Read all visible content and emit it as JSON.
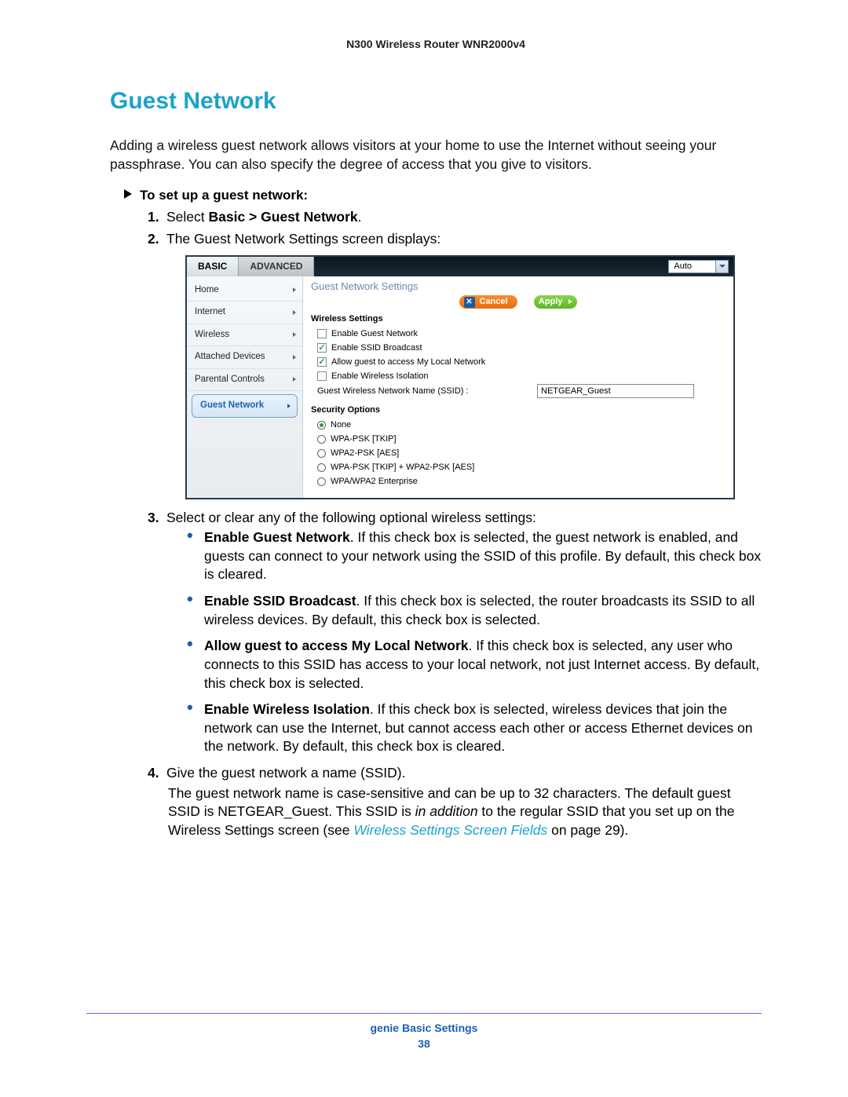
{
  "doc_header": "N300 Wireless Router WNR2000v4",
  "section_title": "Guest Network",
  "intro": "Adding a wireless guest network allows visitors at your home to use the Internet without seeing your passphrase. You can also specify the degree of access that you give to visitors.",
  "procedure_head": "To set up a guest network:",
  "steps": {
    "s1_num": "1.",
    "s1_pre": "Select ",
    "s1_bold": "Basic > Guest Network",
    "s1_post": ".",
    "s2_num": "2.",
    "s2_text": "The Guest Network Settings screen displays:",
    "s3_num": "3.",
    "s3_text": "Select or clear any of the following optional wireless settings:",
    "s4_num": "4.",
    "s4_text": "Give the guest network a name (SSID).",
    "s4_sub_pre": "The guest network name is case-sensitive and can be up to 32 characters. The default guest SSID is NETGEAR_Guest. This SSID is ",
    "s4_sub_italic": "in addition",
    "s4_sub_mid": " to the regular SSID that you set up on the Wireless Settings screen (see ",
    "s4_sub_link": "Wireless Settings Screen Fields ",
    "s4_sub_post": "on page 29)."
  },
  "bullets": {
    "b1_bold": "Enable Guest Network",
    "b1_text": ". If this check box is selected, the guest network is enabled, and guests can connect to your network using the SSID of this profile. By default, this check box is cleared.",
    "b2_bold": "Enable SSID Broadcast",
    "b2_text": ". If this check box is selected, the router broadcasts its SSID to all wireless devices. By default, this check box is selected.",
    "b3_bold": "Allow guest to access My Local Network",
    "b3_text": ". If this check box is selected, any user who connects to this SSID has access to your local network, not just Internet access. By default, this check box is selected.",
    "b4_bold": "Enable Wireless Isolation",
    "b4_text": ". If this check box is selected, wireless devices that join the network can use the Internet, but cannot access each other or access Ethernet devices on the network. By default, this check box is cleared."
  },
  "ui": {
    "tab_basic": "BASIC",
    "tab_advanced": "ADVANCED",
    "auto": "Auto",
    "sidebar": [
      "Home",
      "Internet",
      "Wireless",
      "Attached Devices",
      "Parental Controls",
      "Guest Network"
    ],
    "panel_title": "Guest Network Settings",
    "cancel": "Cancel",
    "apply": "Apply",
    "sec_wireless": "Wireless Settings",
    "cb1": "Enable Guest Network",
    "cb2": "Enable SSID Broadcast",
    "cb3": "Allow guest to access My Local Network",
    "cb4": "Enable Wireless Isolation",
    "ssid_label": "Guest Wireless Network Name (SSID) :",
    "ssid_value": "NETGEAR_Guest",
    "sec_security": "Security Options",
    "r1": "None",
    "r2": "WPA-PSK [TKIP]",
    "r3": "WPA2-PSK [AES]",
    "r4": "WPA-PSK [TKIP] + WPA2-PSK [AES]",
    "r5": "WPA/WPA2 Enterprise"
  },
  "footer_title": "genie Basic Settings",
  "footer_page": "38"
}
